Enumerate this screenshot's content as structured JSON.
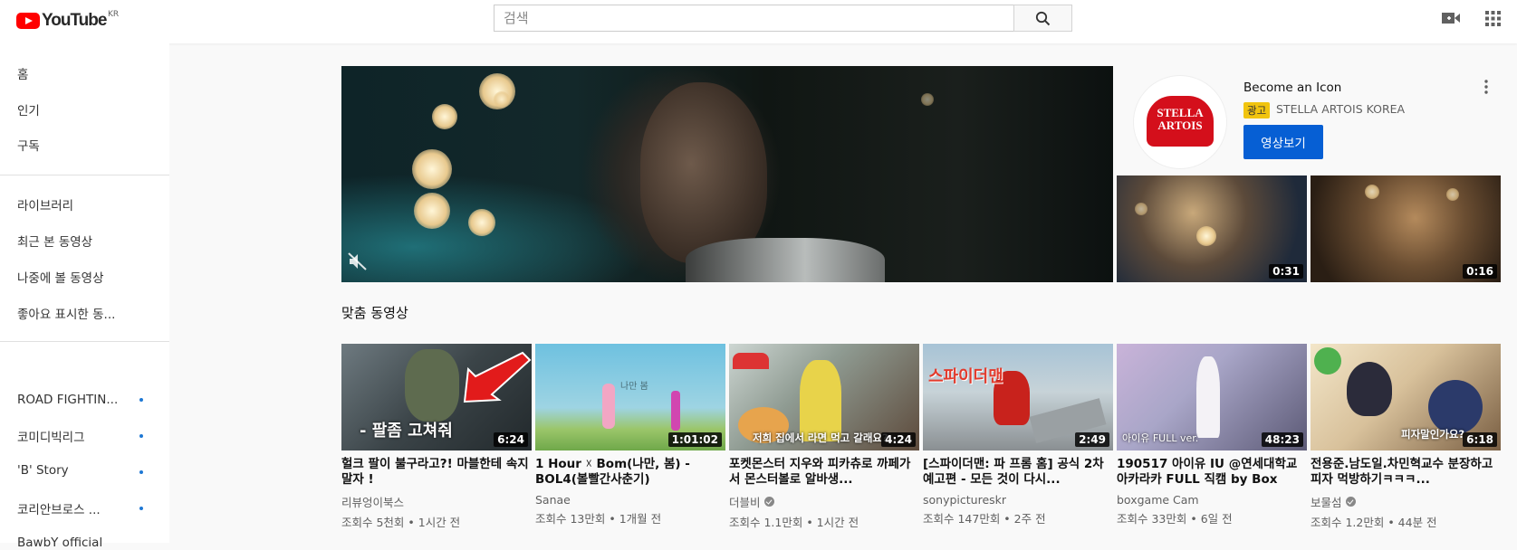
{
  "masthead": {
    "logo_text": "YouTube",
    "country_code": "KR",
    "search_placeholder": "검색",
    "icons": [
      "search-icon",
      "video-camera-icon",
      "apps-grid-icon"
    ]
  },
  "sidebar": {
    "primary": [
      {
        "label": "홈"
      },
      {
        "label": "인기"
      },
      {
        "label": "구독"
      }
    ],
    "library": [
      {
        "label": "라이브러리"
      },
      {
        "label": "최근 본 동영상"
      },
      {
        "label": "나중에 볼 동영상"
      },
      {
        "label": "좋아요 표시한 동..."
      }
    ],
    "subscriptions": [
      {
        "label": "ROAD FIGHTIN..."
      },
      {
        "label": "코미디빅리그"
      },
      {
        "label": "'B' Story"
      },
      {
        "label": "코리안브로스 ..."
      },
      {
        "label": "BawbY official"
      }
    ]
  },
  "ad": {
    "title": "Become an Icon",
    "badge": "광고",
    "channel": "STELLA ARTOIS KOREA",
    "cta": "영상보기",
    "logo_text_line1": "STELLA",
    "logo_text_line2": "ARTOIS",
    "thumbs": [
      {
        "duration": "0:31"
      },
      {
        "duration": "0:16"
      }
    ]
  },
  "section": {
    "title": "맞춤 동영상"
  },
  "videos": [
    {
      "title": "헐크 팔이 불구라고?! 마블한테 속지 말자 !",
      "channel": "리뷰엉이북스",
      "verified": false,
      "meta": "조회수 5천회 • 1시간 전",
      "duration": "6:24",
      "overlay": "- 팔좀 고쳐줘"
    },
    {
      "title": "1 Hour ☓ Bom(나만, 봄) - BOL4(볼빨간사춘기)",
      "channel": "Sanae",
      "verified": false,
      "meta": "조회수 13만회 • 1개월 전",
      "duration": "1:01:02",
      "overlay": "나만 봄"
    },
    {
      "title": "포켓몬스터 지우와 피카츄로 까페가서 몬스터볼로 알바생...",
      "channel": "더블비",
      "verified": true,
      "meta": "조회수 1.1만회 • 1시간 전",
      "duration": "4:24",
      "overlay": "저희 집에서 라면 먹고 갈래요?"
    },
    {
      "title": "[스파이더맨: 파 프롬 홈] 공식 2차 예고편 - 모든 것이 다시...",
      "channel": "sonypictureskr",
      "verified": false,
      "meta": "조회수 147만회 • 2주 전",
      "duration": "2:49",
      "overlay": "스파이더맨"
    },
    {
      "title": "190517 아이유 IU @연세대학교 아카라카 FULL 직캠 by Box",
      "channel": "boxgame Cam",
      "verified": false,
      "meta": "조회수 33만회 • 6일 전",
      "duration": "48:23",
      "overlay": "아이유 FULL ver."
    },
    {
      "title": "전용준.남도일.차민혁교수 분장하고 피자 먹방하기ㅋㅋㅋ...",
      "channel": "보물섬",
      "verified": true,
      "meta": "조회수 1.2만회 • 44분 전",
      "duration": "6:18",
      "overlay": "피자말인가요?"
    }
  ]
}
